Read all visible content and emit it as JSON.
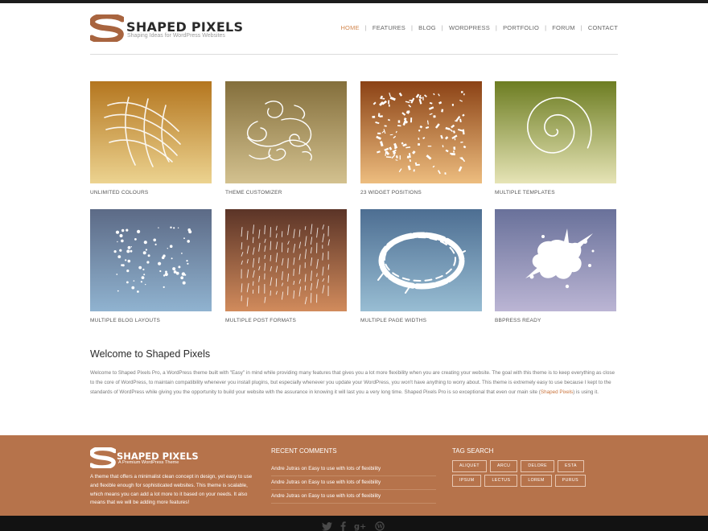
{
  "site": {
    "logo_title": "Shaped Pixels",
    "tagline": "Shaping Ideas for WordPress Websites",
    "accent": "#d3884f"
  },
  "nav": {
    "items": [
      "HOME",
      "FEATURES",
      "BLOG",
      "WORDPRESS",
      "PORTFOLIO",
      "FORUM",
      "CONTACT"
    ],
    "separator": "|",
    "active": "HOME"
  },
  "features": [
    {
      "label": "UNLIMITED COLOURS",
      "icon": "brush-strokes-icon",
      "gradient": [
        "#b4761f",
        "#ecd390"
      ]
    },
    {
      "label": "THEME CUSTOMIZER",
      "icon": "swirl-doodle-icon",
      "gradient": [
        "#846f3c",
        "#d3c18f"
      ]
    },
    {
      "label": "23 WIDGET POSITIONS",
      "icon": "confetti-scatter-icon",
      "gradient": [
        "#8b4215",
        "#edbd7f"
      ]
    },
    {
      "label": "MULTIPLE TEMPLATES",
      "icon": "spiral-icon",
      "gradient": [
        "#6d7d22",
        "#e6e4b6"
      ]
    },
    {
      "label": "MULTIPLE BLOG LAYOUTS",
      "icon": "dot-scatter-icon",
      "gradient": [
        "#5c6a86",
        "#90b3d0"
      ]
    },
    {
      "label": "MULTIPLE POST FORMATS",
      "icon": "dashes-pattern-icon",
      "gradient": [
        "#5b3427",
        "#d18b5c"
      ]
    },
    {
      "label": "MULTIPLE PAGE WIDTHS",
      "icon": "grunge-ring-icon",
      "gradient": [
        "#4d6e92",
        "#98bdd3"
      ]
    },
    {
      "label": "BBPRESS READY",
      "icon": "paint-splat-icon",
      "gradient": [
        "#69719a",
        "#bbb5d4"
      ]
    }
  ],
  "welcome": {
    "title": "Welcome to Shaped Pixels",
    "body_before": "Welcome to Shaped Pixels Pro, a WordPress theme built with \"Easy\" in mind while providing many features that gives you a lot more flexibility when you are creating your website. The goal with this theme is to keep everything as close to the core of WordPress, to maintain compatibility whenever you install plugins, but especially whenever you update your WordPress, you won't have anything to worry about. This theme is extremely easy to use because I kept to the standards of WordPress while giving you the opportunity to build your website with the assurance in knowing it will last you a very long time. Shaped Pixels Pro is so exceptional that even our main site (",
    "link": "Shaped Pixels",
    "body_after": ") is using it."
  },
  "footer": {
    "logo_title": "Shaped Pixels",
    "logo_tagline": "A Premium WordPress Theme",
    "about": "A theme that offers a minimalist clean concept in design, yet easy to use and flexible enough for sophisticated websites. This theme is scalable, which means you can add a lot more to it based on your needs. It also means that we will be adding more features!",
    "comments_heading": "RECENT COMMENTS",
    "comments": [
      "Andre Jutras on Easy to use with lots of flexibility",
      "Andre Jutras on Easy to use with lots of flexibility",
      "Andre Jutras on Easy to use with lots of flexibility"
    ],
    "tags_heading": "TAG SEARCH",
    "tags": [
      "ALIQUET",
      "ARCU",
      "DELORE",
      "ESTA",
      "IPSUM",
      "LECTUS",
      "LOREM",
      "PURUS"
    ],
    "background": "#b6734b"
  },
  "social": [
    "twitter-icon",
    "facebook-icon",
    "google-plus-icon",
    "wordpress-icon"
  ]
}
